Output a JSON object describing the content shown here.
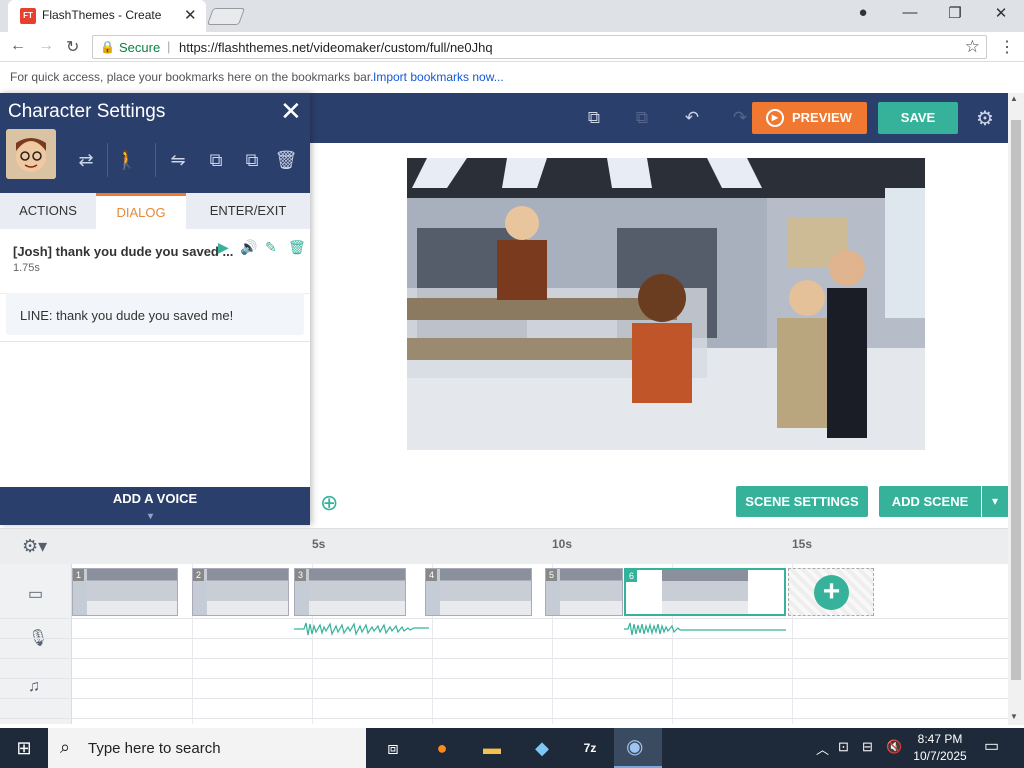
{
  "browser": {
    "tab_title": "FlashThemes - Create",
    "favicon_text": "FT",
    "secure_label": "Secure",
    "url": "https://flashthemes.net/videomaker/custom/full/ne0Jhq",
    "bookmarks_hint": "For quick access, place your bookmarks here on the bookmarks bar.",
    "bookmarks_link": "Import bookmarks now..."
  },
  "toolbar": {
    "preview_label": "PREVIEW",
    "save_label": "SAVE"
  },
  "character_panel": {
    "title": "Character Settings",
    "tabs": [
      "ACTIONS",
      "DIALOG",
      "ENTER/EXIT"
    ],
    "active_tab": "DIALOG",
    "dialog_item": {
      "text": "[Josh] thank you dude you saved ...",
      "duration": "1.75s"
    },
    "line_text": "LINE: thank you dude you saved me!",
    "add_voice_label": "ADD A VOICE"
  },
  "stage": {
    "scene_settings_label": "SCENE SETTINGS",
    "add_scene_label": "ADD SCENE"
  },
  "timeline": {
    "ticks": [
      "5s",
      "10s",
      "15s"
    ],
    "scenes": [
      "1",
      "2",
      "3",
      "4",
      "5",
      "6"
    ],
    "selected_scene": "6"
  },
  "taskbar": {
    "search_placeholder": "Type here to search",
    "time": "8:47 PM",
    "date": "10/7/2025"
  },
  "colors": {
    "accent_teal": "#36b29b",
    "accent_orange": "#f07830",
    "navy": "#2b3f6c"
  }
}
